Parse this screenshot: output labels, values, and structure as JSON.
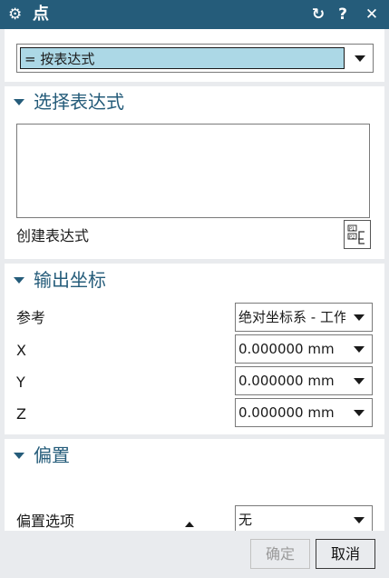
{
  "titlebar": {
    "title": "点",
    "gear_icon": "⚙",
    "reset_icon": "↻",
    "help_icon": "?",
    "close_icon": "✕"
  },
  "type_select": {
    "value": "= 按表达式"
  },
  "select_expression": {
    "header": "选择表达式",
    "create_label": "创建表达式"
  },
  "output_coords": {
    "header": "输出坐标",
    "reference": {
      "label": "参考",
      "value": "绝对坐标系 - 工作部件"
    },
    "x": {
      "label": "X",
      "value": "0.000000 mm"
    },
    "y": {
      "label": "Y",
      "value": "0.000000 mm"
    },
    "z": {
      "label": "Z",
      "value": "0.000000 mm"
    }
  },
  "offset": {
    "header": "偏置",
    "option": {
      "label": "偏置选项",
      "value": "无"
    }
  },
  "buttons": {
    "ok": "确定",
    "cancel": "取消"
  },
  "colors": {
    "titlebar": "#255c7a",
    "section_header": "#255c7a",
    "selection_highlight": "#acd8e6"
  }
}
